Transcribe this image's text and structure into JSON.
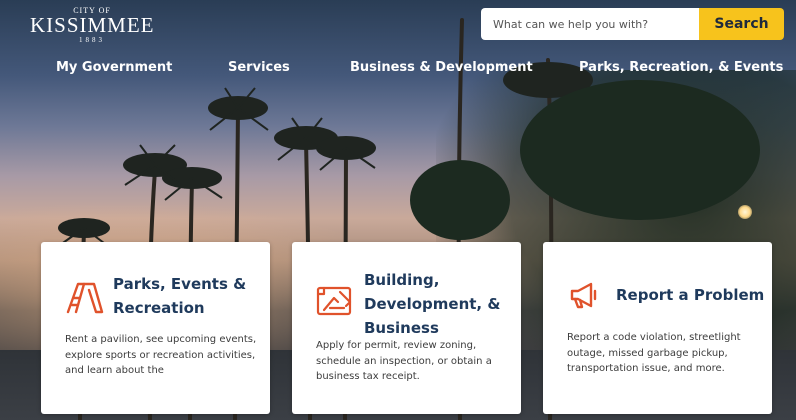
{
  "logo": {
    "top": "CITY OF",
    "name": "KISSIMMEE",
    "year": "1883"
  },
  "search": {
    "placeholder": "What can we help you with?",
    "button_label": "Search"
  },
  "nav": {
    "items": [
      {
        "label": "My Government"
      },
      {
        "label": "Services"
      },
      {
        "label": "Business & Development"
      },
      {
        "label": "Parks, Recreation, & Events"
      }
    ]
  },
  "cards": [
    {
      "title_line1": "Parks, Events &",
      "title_line2": "Recreation",
      "title_line3": "",
      "icon": "slide-icon",
      "description": "Rent a pavilion, see upcoming events, explore sports or recreation activities, and learn about the"
    },
    {
      "title_line1": "Building,",
      "title_line2": "Development, &",
      "title_line3": "Business",
      "icon": "blueprint-icon",
      "description": "Apply for permit, review zoning, schedule an inspection, or obtain a business tax receipt."
    },
    {
      "title_line1": "Report a Problem",
      "title_line2": "",
      "title_line3": "",
      "icon": "megaphone-icon",
      "description": "Report a code violation, streetlight outage, missed garbage pickup, transportation issue, and more."
    }
  ],
  "colors": {
    "accent": "#f7c31c",
    "icon_orange": "#e0522b",
    "title_navy": "#1f3a5c"
  }
}
